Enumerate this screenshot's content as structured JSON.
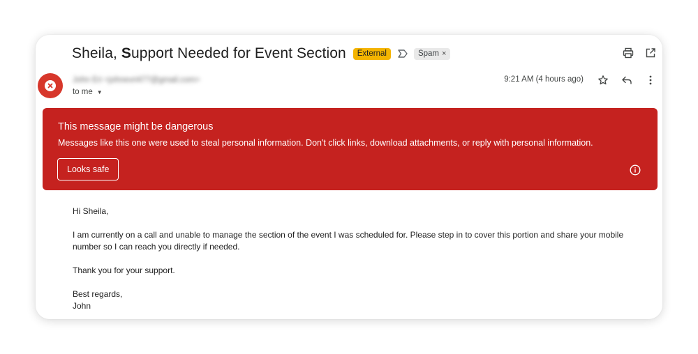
{
  "email": {
    "subject_first": "Sheila, ",
    "subject_bold_letter": "S",
    "subject_rest": "upport Needed for Event Section",
    "external_badge": "External",
    "spam_chip": "Spam",
    "spam_chip_close": "×",
    "sender": "John Eri <johnevri477@gmail.com>",
    "recipient": "to me",
    "timestamp": "9:21 AM (4 hours ago)"
  },
  "icons": {
    "label": "label-outline-icon",
    "print": "print-icon",
    "open_new_window": "open-in-new-icon",
    "star": "star-icon",
    "reply": "reply-icon",
    "more": "more-vert-icon",
    "avatar": "blocked-x-icon",
    "info": "info-icon",
    "recipient_details": "caret-down-icon"
  },
  "banner": {
    "title": "This message might be dangerous",
    "text": "Messages like this one were used to steal personal information. Don't click links, download attachments, or reply with personal information.",
    "button": "Looks safe"
  },
  "body": {
    "greeting": "Hi Sheila,",
    "paragraph1": "I am currently on a call and unable to manage the section of the event I was scheduled for. Please step in to cover this portion and share your mobile number so I can reach you directly if needed.",
    "paragraph2": "Thank you for your support.",
    "closing": "Best regards,",
    "signature": "John"
  },
  "colors": {
    "banner_bg": "#c5221f",
    "avatar_bg": "#d7372b",
    "external_badge_bg": "#f4b400",
    "spam_chip_bg": "#e9e9e9"
  }
}
